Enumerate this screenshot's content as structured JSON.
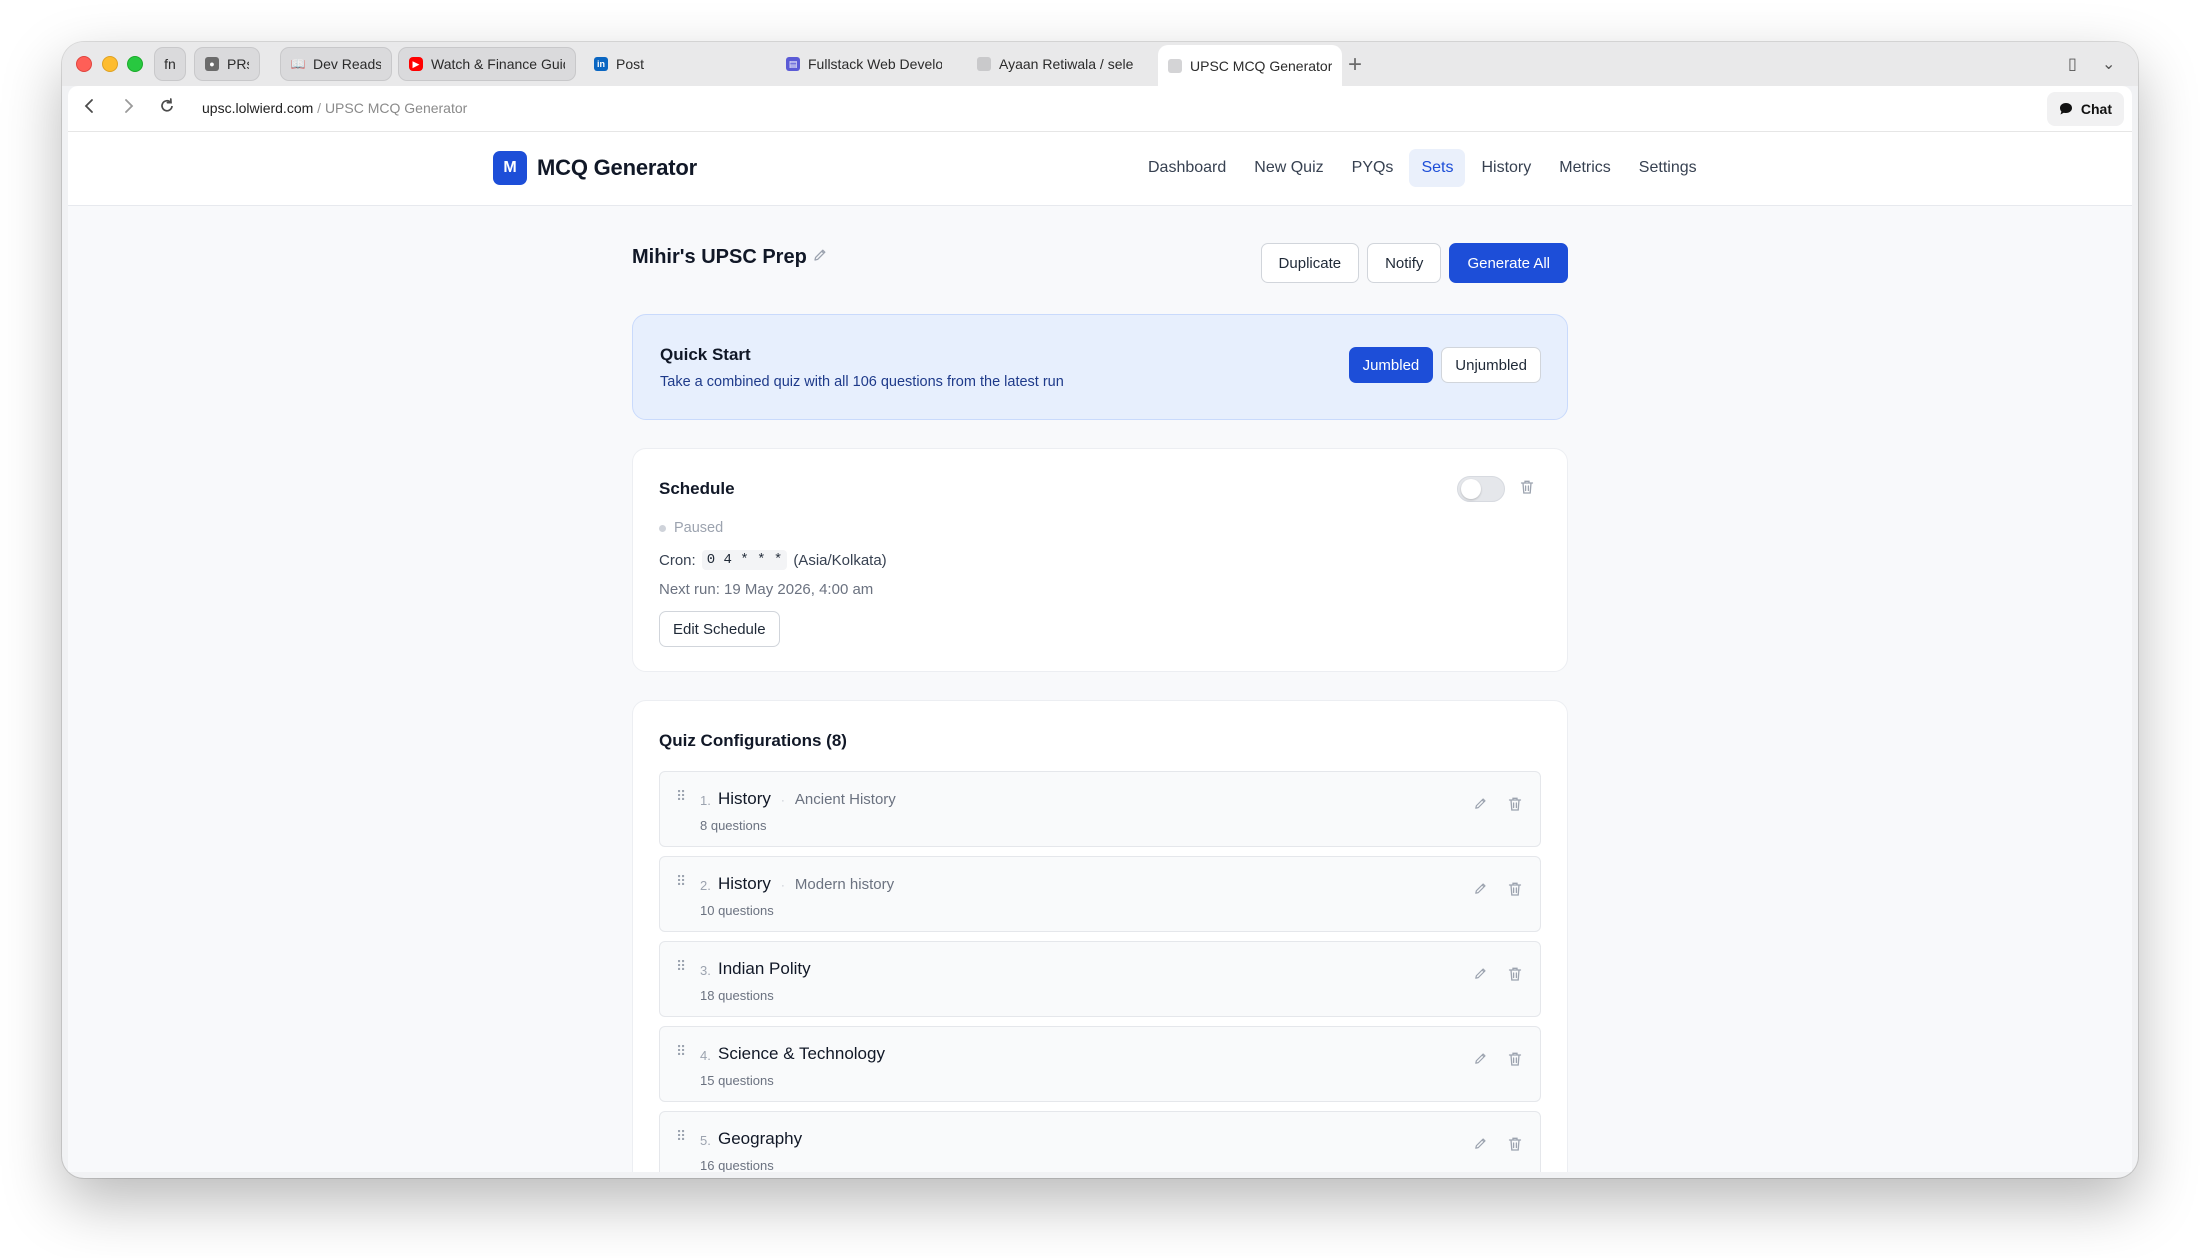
{
  "browser": {
    "tabs": [
      {
        "label": "fn",
        "pinned": true
      },
      {
        "label": "PRs",
        "pinned": true
      },
      {
        "label": "Dev Reads",
        "pinned": true
      },
      {
        "label": "Watch & Finance Guid",
        "pinned": true
      },
      {
        "label": "Post",
        "pinned": false
      },
      {
        "label": "Fullstack Web Develop",
        "pinned": false
      },
      {
        "label": "Ayaan Retiwala / select",
        "pinned": false
      },
      {
        "label": "UPSC MCQ Generator",
        "pinned": false,
        "active": true
      }
    ],
    "url_host": "upsc.lolwierd.com",
    "url_sep": "/",
    "url_title": "UPSC MCQ Generator",
    "chat_label": "Chat"
  },
  "app": {
    "logo_letter": "M",
    "name": "MCQ Generator",
    "nav": [
      "Dashboard",
      "New Quiz",
      "PYQs",
      "Sets",
      "History",
      "Metrics",
      "Settings"
    ],
    "active_nav": "Sets",
    "accent_color": "#1d4ed8"
  },
  "set": {
    "title": "Mihir's UPSC Prep",
    "actions": {
      "duplicate": "Duplicate",
      "notify": "Notify",
      "generate_all": "Generate All"
    }
  },
  "quick_start": {
    "title": "Quick Start",
    "description": "Take a combined quiz with all 106 questions from the latest run",
    "jumbled": "Jumbled",
    "unjumbled": "Unjumbled"
  },
  "schedule": {
    "title": "Schedule",
    "enabled": false,
    "status": "Paused",
    "cron_label": "Cron:",
    "cron_expr": "0 4 * * *",
    "timezone": "(Asia/Kolkata)",
    "next_run": "Next run: 19 May 2026, 4:00 am",
    "edit_label": "Edit Schedule"
  },
  "configs": {
    "title": "Quiz Configurations (8)",
    "items": [
      {
        "num": "1.",
        "subject": "History",
        "topic": "Ancient History",
        "count": "8 questions"
      },
      {
        "num": "2.",
        "subject": "History",
        "topic": "Modern history",
        "count": "10 questions"
      },
      {
        "num": "3.",
        "subject": "Indian Polity",
        "topic": "",
        "count": "18 questions"
      },
      {
        "num": "4.",
        "subject": "Science & Technology",
        "topic": "",
        "count": "15 questions"
      },
      {
        "num": "5.",
        "subject": "Geography",
        "topic": "",
        "count": "16 questions"
      }
    ]
  }
}
